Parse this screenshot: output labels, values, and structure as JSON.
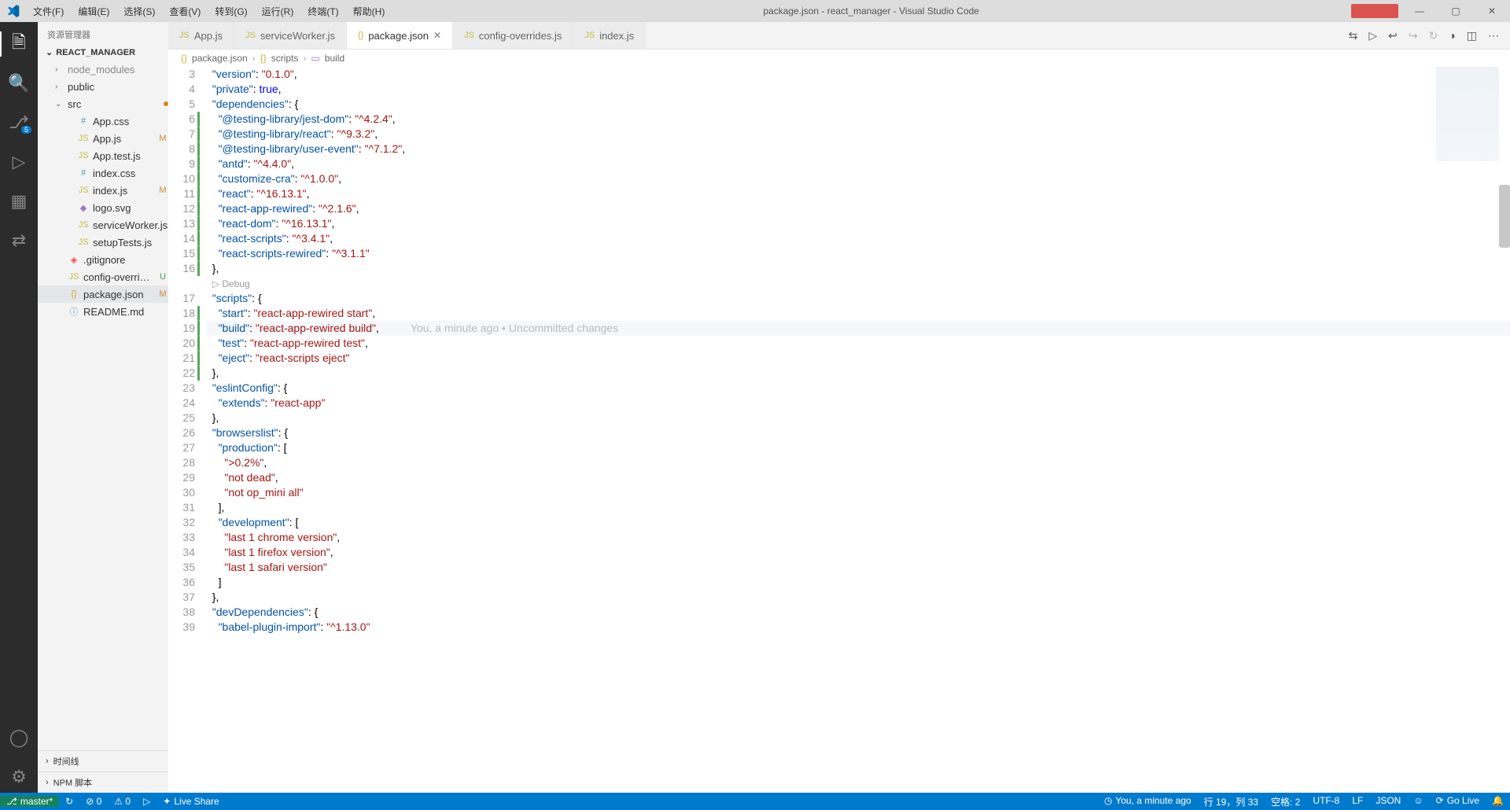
{
  "window": {
    "title": "package.json - react_manager - Visual Studio Code"
  },
  "menu": [
    "文件(F)",
    "编辑(E)",
    "选择(S)",
    "查看(V)",
    "转到(G)",
    "运行(R)",
    "终端(T)",
    "帮助(H)"
  ],
  "activity": {
    "scm_badge": "5"
  },
  "sidebar": {
    "title": "资源管理器",
    "project": "REACT_MANAGER",
    "tree": [
      {
        "type": "folder",
        "name": "node_modules",
        "indent": 1,
        "expanded": false,
        "dim": true
      },
      {
        "type": "folder",
        "name": "public",
        "indent": 1,
        "expanded": false
      },
      {
        "type": "folder",
        "name": "src",
        "indent": 1,
        "expanded": true,
        "dot": true
      },
      {
        "type": "file",
        "name": "App.css",
        "icon": "#",
        "iconcls": "ic-css",
        "indent": 2
      },
      {
        "type": "file",
        "name": "App.js",
        "icon": "JS",
        "iconcls": "ic-js",
        "indent": 2,
        "status": "M"
      },
      {
        "type": "file",
        "name": "App.test.js",
        "icon": "JS",
        "iconcls": "ic-js",
        "indent": 2
      },
      {
        "type": "file",
        "name": "index.css",
        "icon": "#",
        "iconcls": "ic-css",
        "indent": 2
      },
      {
        "type": "file",
        "name": "index.js",
        "icon": "JS",
        "iconcls": "ic-js",
        "indent": 2,
        "status": "M"
      },
      {
        "type": "file",
        "name": "logo.svg",
        "icon": "◆",
        "iconcls": "ic-svg",
        "indent": 2
      },
      {
        "type": "file",
        "name": "serviceWorker.js",
        "icon": "JS",
        "iconcls": "ic-js",
        "indent": 2
      },
      {
        "type": "file",
        "name": "setupTests.js",
        "icon": "JS",
        "iconcls": "ic-js",
        "indent": 2
      },
      {
        "type": "file",
        "name": ".gitignore",
        "icon": "◈",
        "iconcls": "ic-git",
        "indent": 1
      },
      {
        "type": "file",
        "name": "config-overrides.js",
        "icon": "JS",
        "iconcls": "ic-js",
        "indent": 1,
        "status": "U"
      },
      {
        "type": "file",
        "name": "package.json",
        "icon": "{}",
        "iconcls": "ic-json",
        "indent": 1,
        "status": "M",
        "selected": true
      },
      {
        "type": "file",
        "name": "README.md",
        "icon": "ⓘ",
        "iconcls": "ic-info",
        "indent": 1
      }
    ],
    "panels": [
      "时间线",
      "NPM 脚本"
    ]
  },
  "tabs": [
    {
      "icon": "JS",
      "iconcls": "ic-js",
      "label": "App.js"
    },
    {
      "icon": "JS",
      "iconcls": "ic-js",
      "label": "serviceWorker.js"
    },
    {
      "icon": "{}",
      "iconcls": "ic-json",
      "label": "package.json",
      "active": true,
      "close": true
    },
    {
      "icon": "JS",
      "iconcls": "ic-js",
      "label": "config-overrides.js"
    },
    {
      "icon": "JS",
      "iconcls": "ic-js",
      "label": "index.js"
    }
  ],
  "breadcrumbs": {
    "file": "package.json",
    "seg1": "scripts",
    "seg2": "build"
  },
  "code": {
    "blame": "You, a minute ago • Uncommitted changes",
    "debug_lens": "Debug",
    "lines": [
      {
        "n": 3,
        "html": "  <span class='k-key'>\"version\"</span><span class='k-punc'>: </span><span class='k-str'>\"0.1.0\"</span><span class='k-punc'>,</span>"
      },
      {
        "n": 4,
        "html": "  <span class='k-key'>\"private\"</span><span class='k-punc'>: </span><span class='k-bool'>true</span><span class='k-punc'>,</span>"
      },
      {
        "n": 5,
        "html": "  <span class='k-key'>\"dependencies\"</span><span class='k-punc'>: {</span>"
      },
      {
        "n": 6,
        "mod": true,
        "html": "    <span class='k-key'>\"@testing-library/jest-dom\"</span><span class='k-punc'>: </span><span class='k-str'>\"^4.2.4\"</span><span class='k-punc'>,</span>"
      },
      {
        "n": 7,
        "mod": true,
        "html": "    <span class='k-key'>\"@testing-library/react\"</span><span class='k-punc'>: </span><span class='k-str'>\"^9.3.2\"</span><span class='k-punc'>,</span>"
      },
      {
        "n": 8,
        "mod": true,
        "html": "    <span class='k-key'>\"@testing-library/user-event\"</span><span class='k-punc'>: </span><span class='k-str'>\"^7.1.2\"</span><span class='k-punc'>,</span>"
      },
      {
        "n": 9,
        "mod": true,
        "html": "    <span class='k-key'>\"antd\"</span><span class='k-punc'>: </span><span class='k-str'>\"^4.4.0\"</span><span class='k-punc'>,</span>"
      },
      {
        "n": 10,
        "mod": true,
        "html": "    <span class='k-key'>\"customize-cra\"</span><span class='k-punc'>: </span><span class='k-str'>\"^1.0.0\"</span><span class='k-punc'>,</span>"
      },
      {
        "n": 11,
        "mod": true,
        "html": "    <span class='k-key'>\"react\"</span><span class='k-punc'>: </span><span class='k-str'>\"^16.13.1\"</span><span class='k-punc'>,</span>"
      },
      {
        "n": 12,
        "mod": true,
        "html": "    <span class='k-key'>\"react-app-rewired\"</span><span class='k-punc'>: </span><span class='k-str'>\"^2.1.6\"</span><span class='k-punc'>,</span>"
      },
      {
        "n": 13,
        "mod": true,
        "html": "    <span class='k-key'>\"react-dom\"</span><span class='k-punc'>: </span><span class='k-str'>\"^16.13.1\"</span><span class='k-punc'>,</span>"
      },
      {
        "n": 14,
        "mod": true,
        "html": "    <span class='k-key'>\"react-scripts\"</span><span class='k-punc'>: </span><span class='k-str'>\"^3.4.1\"</span><span class='k-punc'>,</span>"
      },
      {
        "n": 15,
        "mod": true,
        "html": "    <span class='k-key'>\"react-scripts-rewired\"</span><span class='k-punc'>: </span><span class='k-str'>\"^3.1.1\"</span>"
      },
      {
        "n": 16,
        "mod": true,
        "html": "  <span class='k-punc'>},</span>"
      },
      {
        "lens": true
      },
      {
        "n": 17,
        "html": "  <span class='k-key'>\"scripts\"</span><span class='k-punc'>: {</span>"
      },
      {
        "n": 18,
        "mod": true,
        "html": "    <span class='k-key'>\"start\"</span><span class='k-punc'>: </span><span class='k-str'>\"react-app-rewired start\"</span><span class='k-punc'>,</span>"
      },
      {
        "n": 19,
        "mod": true,
        "current": true,
        "html": "    <span class='k-key'>\"build\"</span><span class='k-punc'>: </span><span class='k-str'>\"react-app-rewired build\"</span><span class='k-punc'>,</span><span class='blame'>You, a minute ago • Uncommitted changes</span>"
      },
      {
        "n": 20,
        "mod": true,
        "html": "    <span class='k-key'>\"test\"</span><span class='k-punc'>: </span><span class='k-str'>\"react-app-rewired test\"</span><span class='k-punc'>,</span>"
      },
      {
        "n": 21,
        "mod": true,
        "html": "    <span class='k-key'>\"eject\"</span><span class='k-punc'>: </span><span class='k-str'>\"react-scripts eject\"</span>"
      },
      {
        "n": 22,
        "mod": true,
        "html": "  <span class='k-punc'>},</span>"
      },
      {
        "n": 23,
        "html": "  <span class='k-key'>\"eslintConfig\"</span><span class='k-punc'>: {</span>"
      },
      {
        "n": 24,
        "html": "    <span class='k-key'>\"extends\"</span><span class='k-punc'>: </span><span class='k-str'>\"react-app\"</span>"
      },
      {
        "n": 25,
        "html": "  <span class='k-punc'>},</span>"
      },
      {
        "n": 26,
        "html": "  <span class='k-key'>\"browserslist\"</span><span class='k-punc'>: {</span>"
      },
      {
        "n": 27,
        "html": "    <span class='k-key'>\"production\"</span><span class='k-punc'>: [</span>"
      },
      {
        "n": 28,
        "html": "      <span class='k-str'>\">0.2%\"</span><span class='k-punc'>,</span>"
      },
      {
        "n": 29,
        "html": "      <span class='k-str'>\"not dead\"</span><span class='k-punc'>,</span>"
      },
      {
        "n": 30,
        "html": "      <span class='k-str'>\"not op_mini all\"</span>"
      },
      {
        "n": 31,
        "html": "    <span class='k-punc'>],</span>"
      },
      {
        "n": 32,
        "html": "    <span class='k-key'>\"development\"</span><span class='k-punc'>: [</span>"
      },
      {
        "n": 33,
        "html": "      <span class='k-str'>\"last 1 chrome version\"</span><span class='k-punc'>,</span>"
      },
      {
        "n": 34,
        "html": "      <span class='k-str'>\"last 1 firefox version\"</span><span class='k-punc'>,</span>"
      },
      {
        "n": 35,
        "html": "      <span class='k-str'>\"last 1 safari version\"</span>"
      },
      {
        "n": 36,
        "html": "    <span class='k-punc'>]</span>"
      },
      {
        "n": 37,
        "html": "  <span class='k-punc'>},</span>"
      },
      {
        "n": 38,
        "html": "  <span class='k-key'>\"devDependencies\"</span><span class='k-punc'>: {</span>"
      },
      {
        "n": 39,
        "html": "    <span class='k-key'>\"babel-plugin-import\"</span><span class='k-punc'>: </span><span class='k-str'>\"^1.13.0\"</span>"
      }
    ]
  },
  "status": {
    "branch": "master*",
    "sync": "↻",
    "errors": "⊘ 0",
    "warnings": "⚠ 0",
    "live": "Live Share",
    "blame": "You, a minute ago",
    "cursor": "行 19，列 33",
    "spaces": "空格: 2",
    "enc": "UTF-8",
    "eol": "LF",
    "lang": "JSON",
    "feedback": "☺",
    "golive": "Go Live",
    "bell": "🔔"
  }
}
